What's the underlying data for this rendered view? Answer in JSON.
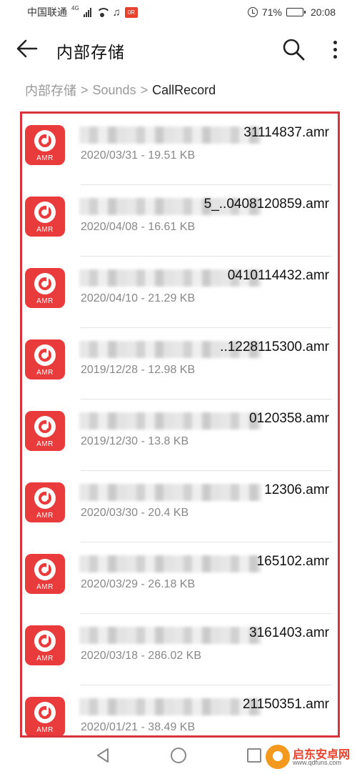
{
  "status_bar": {
    "carrier": "中国联通",
    "network": "4G",
    "battery": "71%",
    "battery_level": 0.71,
    "time": "20:08",
    "app_badge": "0R"
  },
  "header": {
    "title": "内部存储",
    "back_icon": "arrow-left-icon",
    "search_icon": "search-icon",
    "more_icon": "more-vertical-icon"
  },
  "breadcrumb": {
    "items": [
      "内部存储",
      "Sounds",
      "CallRecord"
    ],
    "separator": ">"
  },
  "files": [
    {
      "name_suffix": "31114837.amr",
      "meta": "2020/03/31 - 19.51 KB",
      "icon_label": "AMR"
    },
    {
      "name_suffix": "5_..0408120859.amr",
      "meta": "2020/04/08 - 16.61 KB",
      "icon_label": "AMR"
    },
    {
      "name_suffix": "0410114432.amr",
      "meta": "2020/04/10 - 21.29 KB",
      "icon_label": "AMR"
    },
    {
      "name_suffix": "..1228115300.amr",
      "meta": "2019/12/28 - 12.98 KB",
      "icon_label": "AMR"
    },
    {
      "name_suffix": "0120358.amr",
      "meta": "2019/12/30 - 13.8 KB",
      "icon_label": "AMR"
    },
    {
      "name_suffix": "12306.amr",
      "meta": "2020/03/30 - 20.4 KB",
      "icon_label": "AMR"
    },
    {
      "name_suffix": "165102.amr",
      "meta": "2020/03/29 - 26.18 KB",
      "icon_label": "AMR"
    },
    {
      "name_suffix": "3161403.amr",
      "meta": "2020/03/18 - 286.02 KB",
      "icon_label": "AMR"
    },
    {
      "name_suffix": "21150351.amr",
      "meta": "2020/01/21 - 38.49 KB",
      "icon_label": "AMR"
    }
  ],
  "navbar": {
    "back_icon": "triangle-back-icon",
    "home_icon": "circle-home-icon",
    "recent_icon": "square-recent-icon"
  },
  "watermark": {
    "text": "启东安卓网",
    "sub": "www.qdfuns.com"
  },
  "colors": {
    "accent": "#e93b3b",
    "highlight_border": "#d8323a",
    "secondary_text": "#888888"
  }
}
